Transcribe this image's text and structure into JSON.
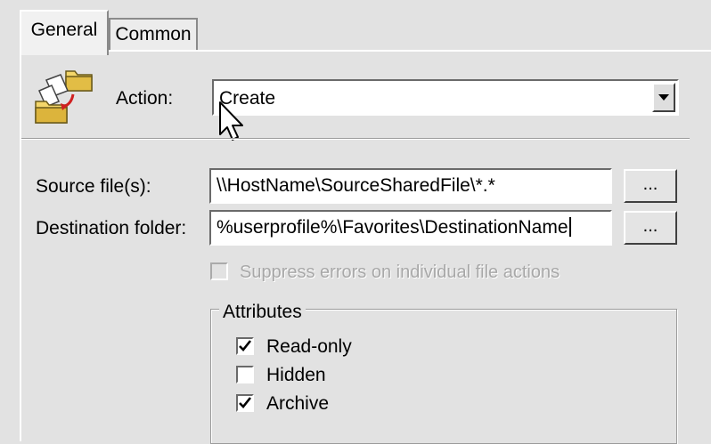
{
  "tabs": [
    {
      "label": "General"
    },
    {
      "label": "Common"
    }
  ],
  "action": {
    "label": "Action:",
    "value": "Create",
    "icon": "folder-copy-icon"
  },
  "source": {
    "label": "Source file(s):",
    "value": "\\\\HostName\\SourceSharedFile\\*.*",
    "browse": "..."
  },
  "destination": {
    "label": "Destination folder:",
    "value": "%userprofile%\\Favorites\\DestinationName",
    "browse": "..."
  },
  "suppress": {
    "label": "Suppress errors on individual file actions",
    "checked": false,
    "enabled": false
  },
  "attributes": {
    "title": "Attributes",
    "items": [
      {
        "label": "Read-only",
        "checked": true
      },
      {
        "label": "Hidden",
        "checked": false
      },
      {
        "label": "Archive",
        "checked": true
      }
    ]
  }
}
